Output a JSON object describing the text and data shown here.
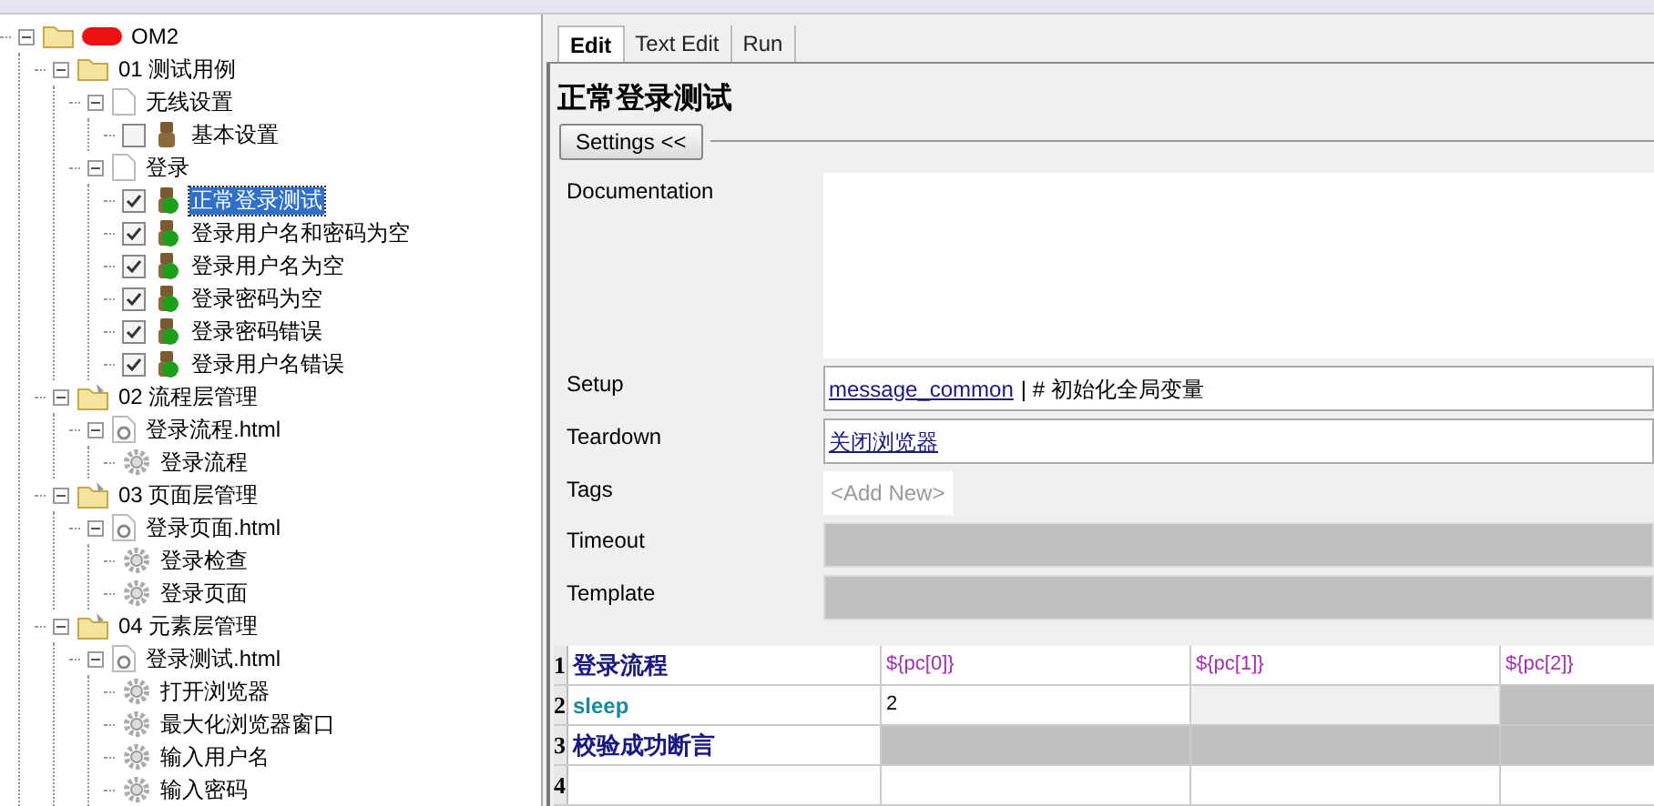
{
  "tree": [
    {
      "label": "OM2",
      "kind": "folder",
      "expanded": true,
      "redacted": true,
      "children": [
        {
          "label": "01 测试用例",
          "kind": "folder",
          "expanded": true,
          "children": [
            {
              "label": "无线设置",
              "kind": "file",
              "expanded": true,
              "children": [
                {
                  "label": "基本设置",
                  "kind": "test",
                  "checked": false,
                  "selected": false,
                  "passed": false
                }
              ]
            },
            {
              "label": "登录",
              "kind": "file",
              "expanded": true,
              "children": [
                {
                  "label": "正常登录测试",
                  "kind": "test",
                  "checked": true,
                  "selected": true,
                  "passed": true
                },
                {
                  "label": "登录用户名和密码为空",
                  "kind": "test",
                  "checked": true,
                  "selected": false,
                  "passed": true
                },
                {
                  "label": "登录用户名为空",
                  "kind": "test",
                  "checked": true,
                  "selected": false,
                  "passed": true
                },
                {
                  "label": "登录密码为空",
                  "kind": "test",
                  "checked": true,
                  "selected": false,
                  "passed": true
                },
                {
                  "label": "登录密码错误",
                  "kind": "test",
                  "checked": true,
                  "selected": false,
                  "passed": true
                },
                {
                  "label": "登录用户名错误",
                  "kind": "test",
                  "checked": true,
                  "selected": false,
                  "passed": true
                }
              ]
            }
          ]
        },
        {
          "label": "02 流程层管理",
          "kind": "resource_folder",
          "expanded": true,
          "children": [
            {
              "label": "登录流程.html",
              "kind": "resource",
              "expanded": true,
              "children": [
                {
                  "label": "登录流程",
                  "kind": "keyword"
                }
              ]
            }
          ]
        },
        {
          "label": "03 页面层管理",
          "kind": "resource_folder",
          "expanded": true,
          "children": [
            {
              "label": "登录页面.html",
              "kind": "resource",
              "expanded": true,
              "children": [
                {
                  "label": "登录检查",
                  "kind": "keyword"
                },
                {
                  "label": "登录页面",
                  "kind": "keyword"
                }
              ]
            }
          ]
        },
        {
          "label": "04 元素层管理",
          "kind": "resource_folder",
          "expanded": true,
          "children": [
            {
              "label": "登录测试.html",
              "kind": "resource",
              "expanded": true,
              "children": [
                {
                  "label": "打开浏览器",
                  "kind": "keyword"
                },
                {
                  "label": "最大化浏览器窗口",
                  "kind": "keyword"
                },
                {
                  "label": "输入用户名",
                  "kind": "keyword"
                },
                {
                  "label": "输入密码",
                  "kind": "keyword"
                }
              ]
            }
          ]
        }
      ]
    }
  ],
  "tabs": [
    {
      "label": "Edit",
      "selected": true
    },
    {
      "label": "Text Edit",
      "selected": false
    },
    {
      "label": "Run",
      "selected": false
    }
  ],
  "title": "正常登录测试",
  "settings_button": "Settings <<",
  "settings": [
    {
      "label": "Documentation",
      "kind": "textarea"
    },
    {
      "label": "Setup",
      "kind": "field",
      "link": "message_common",
      "comment": "| # 初始化全局变量"
    },
    {
      "label": "Teardown",
      "kind": "field",
      "link": "关闭浏览器"
    },
    {
      "label": "Tags",
      "kind": "tags",
      "placeholder": "<Add New>"
    },
    {
      "label": "Timeout",
      "kind": "disabled"
    },
    {
      "label": "Template",
      "kind": "disabled"
    }
  ],
  "grid": [
    {
      "number": "1",
      "cells": [
        {
          "text": "登录流程",
          "kind": "user_keyword"
        },
        {
          "text": "${pc[0]}",
          "kind": "variable"
        },
        {
          "text": "${pc[1]}",
          "kind": "variable"
        },
        {
          "text": "${pc[2]}",
          "kind": "variable"
        }
      ]
    },
    {
      "number": "2",
      "cells": [
        {
          "text": "sleep",
          "kind": "library_keyword"
        },
        {
          "text": "2",
          "kind": "value"
        },
        {
          "kind": "optional"
        },
        {
          "kind": "unused"
        }
      ]
    },
    {
      "number": "3",
      "cells": [
        {
          "text": "校验成功断言",
          "kind": "user_keyword"
        },
        {
          "kind": "unused"
        },
        {
          "kind": "unused"
        },
        {
          "kind": "unused"
        }
      ]
    },
    {
      "number": "4",
      "cells": [
        {
          "kind": "value"
        },
        {
          "kind": "value"
        },
        {
          "kind": "value"
        },
        {
          "kind": "value"
        }
      ]
    }
  ]
}
